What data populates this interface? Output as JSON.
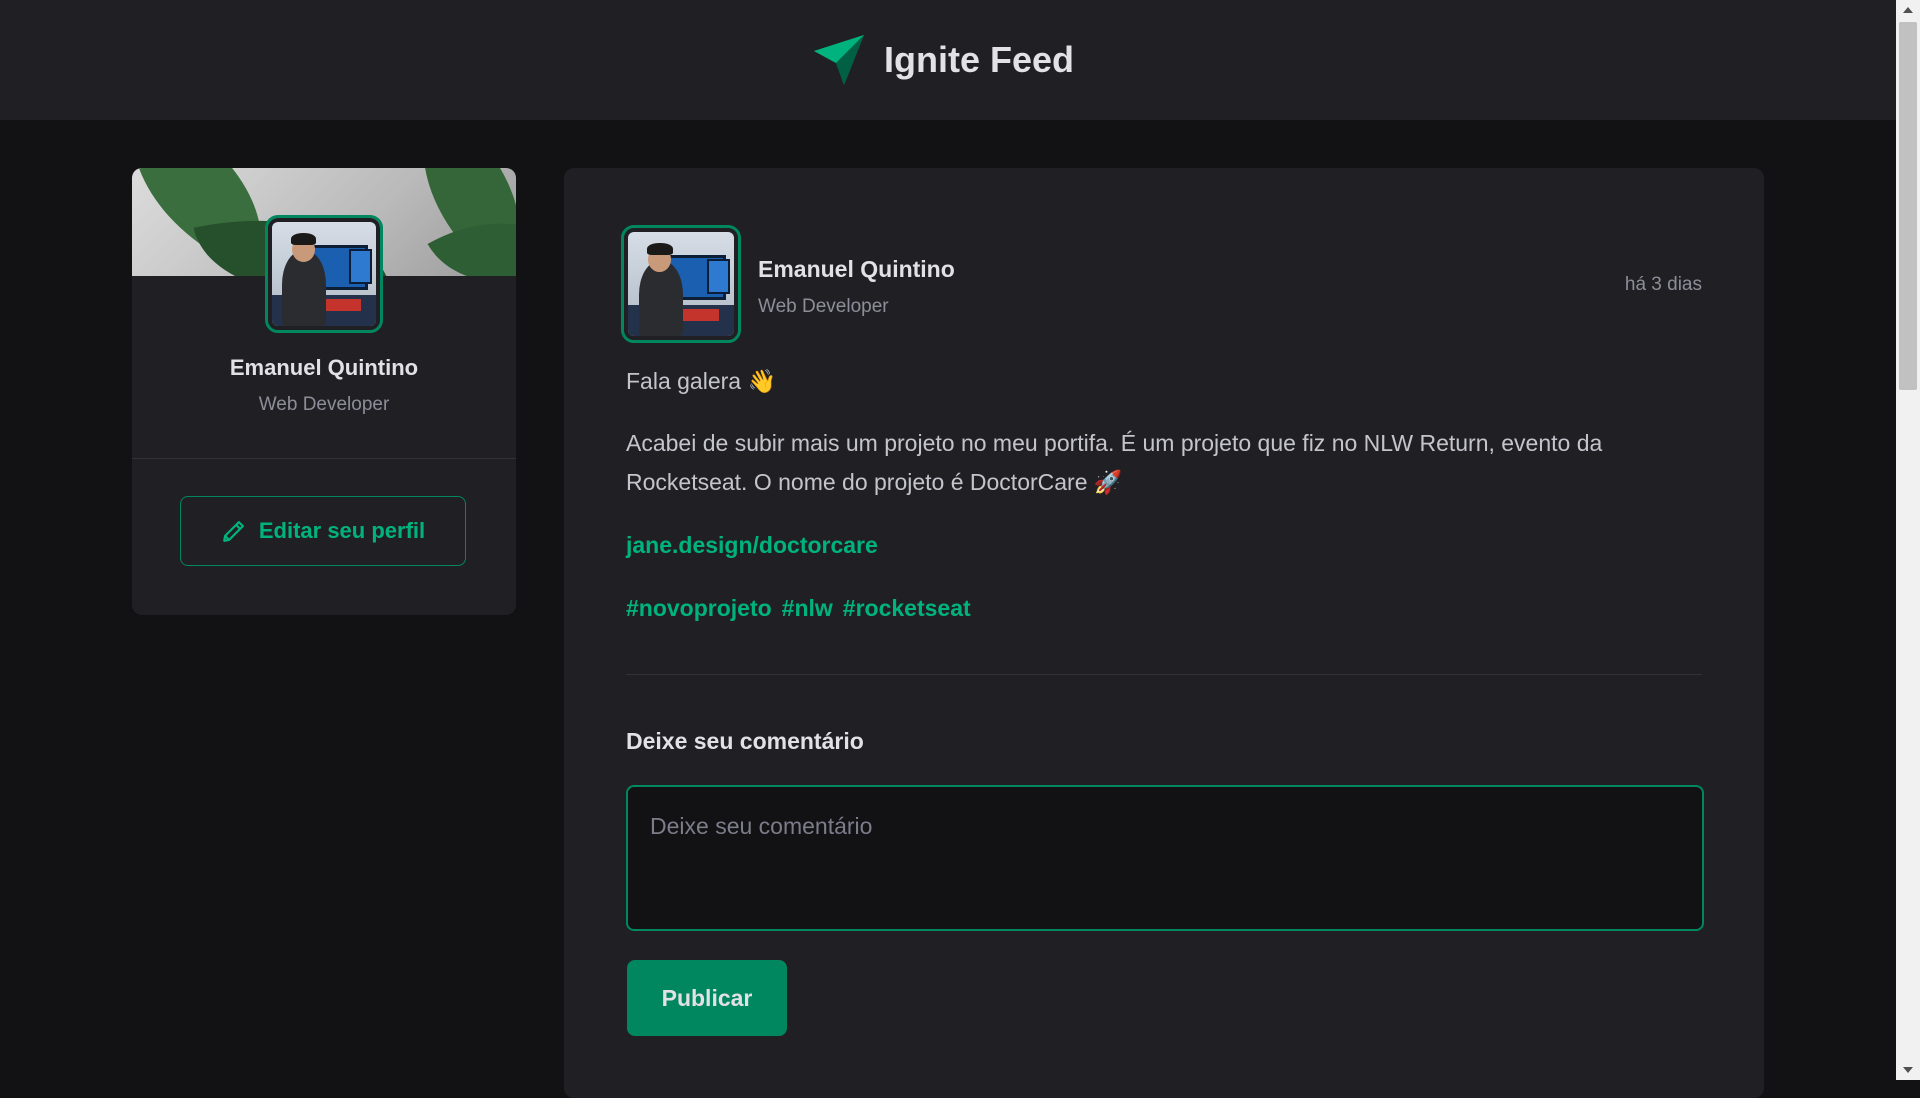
{
  "header": {
    "title": "Ignite Feed",
    "logo_icon": "paper-plane-logo-icon",
    "accent": "#00b37e"
  },
  "sidebar": {
    "profile_name": "Emanuel Quintino",
    "profile_role": "Web Developer",
    "edit_button_label": "Editar seu perfil",
    "edit_icon": "pencil-icon"
  },
  "post": {
    "author_name": "Emanuel Quintino",
    "author_role": "Web Developer",
    "published_relative": "há 3 dias",
    "greeting": "Fala galera 👋",
    "text": "Acabei de subir mais um projeto no meu portifa. É um projeto que fiz no NLW Return, evento da Rocketseat. O nome do projeto é DoctorCare 🚀",
    "link": "jane.design/doctorcare",
    "tags": [
      "#novoprojeto",
      "#nlw",
      "#rocketseat"
    ]
  },
  "comment_form": {
    "label": "Deixe seu comentário",
    "placeholder": "Deixe seu comentário",
    "value": "",
    "submit_label": "Publicar"
  },
  "colors": {
    "background": "#121214",
    "card": "#202024",
    "brand_green": "#00875f",
    "link_green": "#00b37e"
  }
}
